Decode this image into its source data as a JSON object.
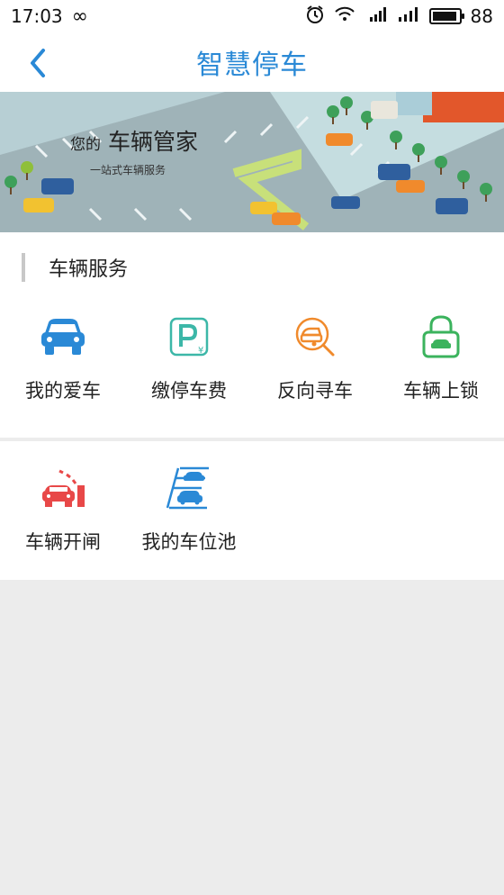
{
  "status_bar": {
    "time": "17:03",
    "battery": "88"
  },
  "header": {
    "title": "智慧停车"
  },
  "banner": {
    "title_prefix": "您的",
    "title_main": "车辆管家",
    "subtitle": "一站式车辆服务"
  },
  "section": {
    "title": "车辆服务"
  },
  "services": [
    {
      "label": "我的爱车",
      "icon": "car-icon",
      "color": "#2a89d6"
    },
    {
      "label": "缴停车费",
      "icon": "parking-fee-icon",
      "color": "#3cb7a8"
    },
    {
      "label": "反向寻车",
      "icon": "find-car-icon",
      "color": "#f08a2c"
    },
    {
      "label": "车辆上锁",
      "icon": "car-lock-icon",
      "color": "#3bb35d"
    },
    {
      "label": "车辆开闸",
      "icon": "gate-icon",
      "color": "#e84848"
    },
    {
      "label": "我的车位池",
      "icon": "parking-pool-icon",
      "color": "#2a89d6"
    }
  ],
  "colors": {
    "accent": "#2a89d6",
    "page_bg": "#ececec"
  }
}
